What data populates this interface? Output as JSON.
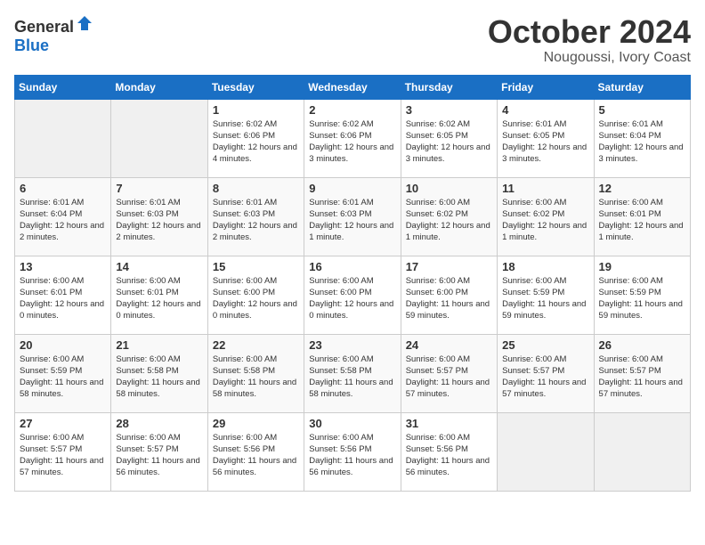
{
  "header": {
    "logo_general": "General",
    "logo_blue": "Blue",
    "month": "October 2024",
    "location": "Nougoussi, Ivory Coast"
  },
  "weekdays": [
    "Sunday",
    "Monday",
    "Tuesday",
    "Wednesday",
    "Thursday",
    "Friday",
    "Saturday"
  ],
  "weeks": [
    [
      {
        "num": "",
        "info": ""
      },
      {
        "num": "",
        "info": ""
      },
      {
        "num": "1",
        "info": "Sunrise: 6:02 AM\nSunset: 6:06 PM\nDaylight: 12 hours and 4 minutes."
      },
      {
        "num": "2",
        "info": "Sunrise: 6:02 AM\nSunset: 6:06 PM\nDaylight: 12 hours and 3 minutes."
      },
      {
        "num": "3",
        "info": "Sunrise: 6:02 AM\nSunset: 6:05 PM\nDaylight: 12 hours and 3 minutes."
      },
      {
        "num": "4",
        "info": "Sunrise: 6:01 AM\nSunset: 6:05 PM\nDaylight: 12 hours and 3 minutes."
      },
      {
        "num": "5",
        "info": "Sunrise: 6:01 AM\nSunset: 6:04 PM\nDaylight: 12 hours and 3 minutes."
      }
    ],
    [
      {
        "num": "6",
        "info": "Sunrise: 6:01 AM\nSunset: 6:04 PM\nDaylight: 12 hours and 2 minutes."
      },
      {
        "num": "7",
        "info": "Sunrise: 6:01 AM\nSunset: 6:03 PM\nDaylight: 12 hours and 2 minutes."
      },
      {
        "num": "8",
        "info": "Sunrise: 6:01 AM\nSunset: 6:03 PM\nDaylight: 12 hours and 2 minutes."
      },
      {
        "num": "9",
        "info": "Sunrise: 6:01 AM\nSunset: 6:03 PM\nDaylight: 12 hours and 1 minute."
      },
      {
        "num": "10",
        "info": "Sunrise: 6:00 AM\nSunset: 6:02 PM\nDaylight: 12 hours and 1 minute."
      },
      {
        "num": "11",
        "info": "Sunrise: 6:00 AM\nSunset: 6:02 PM\nDaylight: 12 hours and 1 minute."
      },
      {
        "num": "12",
        "info": "Sunrise: 6:00 AM\nSunset: 6:01 PM\nDaylight: 12 hours and 1 minute."
      }
    ],
    [
      {
        "num": "13",
        "info": "Sunrise: 6:00 AM\nSunset: 6:01 PM\nDaylight: 12 hours and 0 minutes."
      },
      {
        "num": "14",
        "info": "Sunrise: 6:00 AM\nSunset: 6:01 PM\nDaylight: 12 hours and 0 minutes."
      },
      {
        "num": "15",
        "info": "Sunrise: 6:00 AM\nSunset: 6:00 PM\nDaylight: 12 hours and 0 minutes."
      },
      {
        "num": "16",
        "info": "Sunrise: 6:00 AM\nSunset: 6:00 PM\nDaylight: 12 hours and 0 minutes."
      },
      {
        "num": "17",
        "info": "Sunrise: 6:00 AM\nSunset: 6:00 PM\nDaylight: 11 hours and 59 minutes."
      },
      {
        "num": "18",
        "info": "Sunrise: 6:00 AM\nSunset: 5:59 PM\nDaylight: 11 hours and 59 minutes."
      },
      {
        "num": "19",
        "info": "Sunrise: 6:00 AM\nSunset: 5:59 PM\nDaylight: 11 hours and 59 minutes."
      }
    ],
    [
      {
        "num": "20",
        "info": "Sunrise: 6:00 AM\nSunset: 5:59 PM\nDaylight: 11 hours and 58 minutes."
      },
      {
        "num": "21",
        "info": "Sunrise: 6:00 AM\nSunset: 5:58 PM\nDaylight: 11 hours and 58 minutes."
      },
      {
        "num": "22",
        "info": "Sunrise: 6:00 AM\nSunset: 5:58 PM\nDaylight: 11 hours and 58 minutes."
      },
      {
        "num": "23",
        "info": "Sunrise: 6:00 AM\nSunset: 5:58 PM\nDaylight: 11 hours and 58 minutes."
      },
      {
        "num": "24",
        "info": "Sunrise: 6:00 AM\nSunset: 5:57 PM\nDaylight: 11 hours and 57 minutes."
      },
      {
        "num": "25",
        "info": "Sunrise: 6:00 AM\nSunset: 5:57 PM\nDaylight: 11 hours and 57 minutes."
      },
      {
        "num": "26",
        "info": "Sunrise: 6:00 AM\nSunset: 5:57 PM\nDaylight: 11 hours and 57 minutes."
      }
    ],
    [
      {
        "num": "27",
        "info": "Sunrise: 6:00 AM\nSunset: 5:57 PM\nDaylight: 11 hours and 57 minutes."
      },
      {
        "num": "28",
        "info": "Sunrise: 6:00 AM\nSunset: 5:57 PM\nDaylight: 11 hours and 56 minutes."
      },
      {
        "num": "29",
        "info": "Sunrise: 6:00 AM\nSunset: 5:56 PM\nDaylight: 11 hours and 56 minutes."
      },
      {
        "num": "30",
        "info": "Sunrise: 6:00 AM\nSunset: 5:56 PM\nDaylight: 11 hours and 56 minutes."
      },
      {
        "num": "31",
        "info": "Sunrise: 6:00 AM\nSunset: 5:56 PM\nDaylight: 11 hours and 56 minutes."
      },
      {
        "num": "",
        "info": ""
      },
      {
        "num": "",
        "info": ""
      }
    ]
  ]
}
